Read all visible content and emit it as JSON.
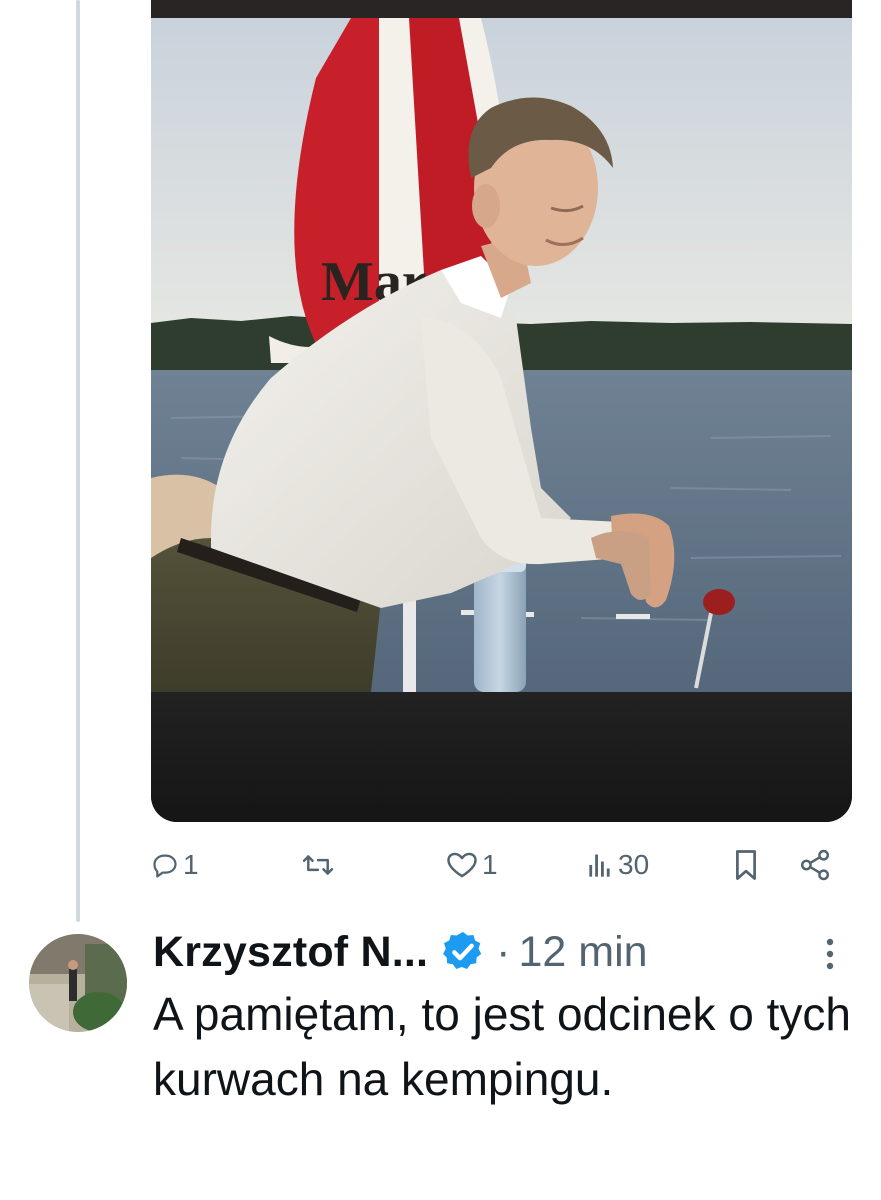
{
  "post": {
    "media": {
      "umbrella_lettering": "Mar"
    },
    "actions": {
      "reply": {
        "icon": "reply-icon",
        "count": "1"
      },
      "repost": {
        "icon": "repost-icon",
        "count": ""
      },
      "like": {
        "icon": "heart-icon",
        "count": "1"
      },
      "views": {
        "icon": "views-icon",
        "count": "30"
      },
      "bookmark": {
        "icon": "bookmark-icon"
      },
      "share": {
        "icon": "share-icon"
      }
    }
  },
  "reply_post": {
    "author_name": "Krzysztof N...",
    "verified": true,
    "separator": "·",
    "timestamp": "12 min",
    "text": "A pamiętam, to jest odcinek o tych kurwach na kempingu."
  },
  "colors": {
    "verified_blue": "#1d9bf0",
    "secondary_text": "#536471",
    "primary_text": "#0f1419",
    "thread_line": "#cfd9de"
  }
}
